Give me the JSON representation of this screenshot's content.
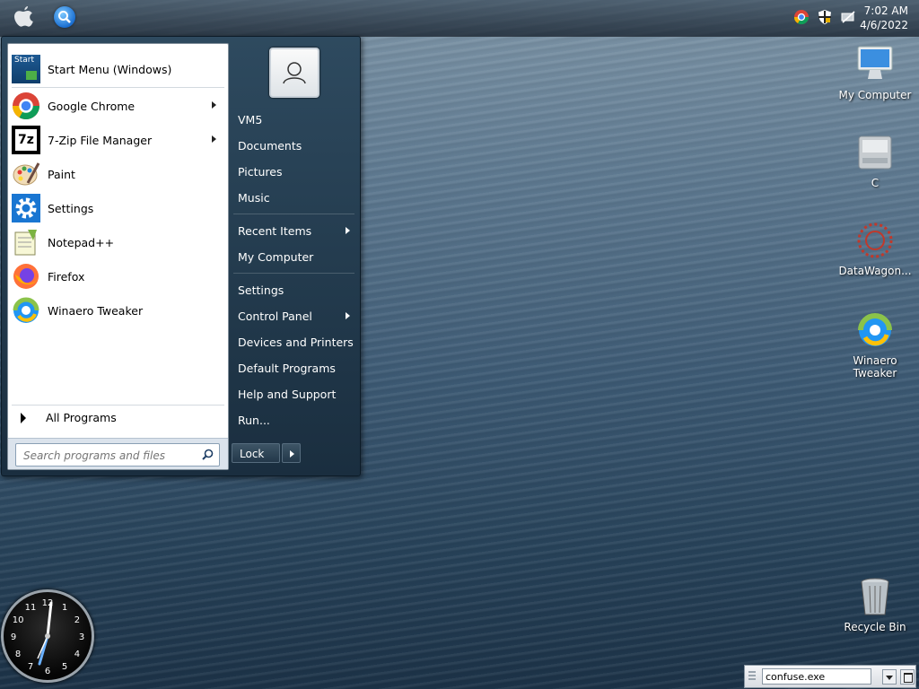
{
  "clock": {
    "time": "7:02 AM",
    "date": "4/6/2022"
  },
  "start_menu": {
    "pinned": [
      {
        "label": "Start Menu (Windows)",
        "icon": "start-menu-icon",
        "has_submenu": false
      },
      {
        "label": "Google Chrome",
        "icon": "chrome-icon",
        "has_submenu": true
      },
      {
        "label": "7-Zip File Manager",
        "icon": "7zip-icon",
        "has_submenu": true
      },
      {
        "label": "Paint",
        "icon": "paint-icon",
        "has_submenu": false
      },
      {
        "label": "Settings",
        "icon": "gear-icon",
        "has_submenu": false
      },
      {
        "label": "Notepad++",
        "icon": "notepadpp-icon",
        "has_submenu": false
      },
      {
        "label": "Firefox",
        "icon": "firefox-icon",
        "has_submenu": false
      },
      {
        "label": "Winaero Tweaker",
        "icon": "winaero-icon",
        "has_submenu": false
      }
    ],
    "start_icon_text": "Start",
    "all_programs": "All Programs",
    "search_placeholder": "Search programs and files",
    "right": {
      "user": "VM5",
      "documents": "Documents",
      "pictures": "Pictures",
      "music": "Music",
      "recent_items": "Recent Items",
      "my_computer": "My Computer",
      "settings": "Settings",
      "control_panel": "Control Panel",
      "devices_printers": "Devices and Printers",
      "default_programs": "Default Programs",
      "help_support": "Help and Support",
      "run": "Run..."
    },
    "lock": "Lock",
    "zip_icon_text": "7z"
  },
  "desktop": {
    "my_computer": "My Computer",
    "c_drive": "C",
    "datawagon": "DataWagon...",
    "winaero_line1": "Winaero",
    "winaero_line2": "Tweaker",
    "recycle_bin": "Recycle Bin"
  },
  "clock_gadget": {
    "numbers": [
      "12",
      "1",
      "2",
      "3",
      "4",
      "5",
      "6",
      "7",
      "8",
      "9",
      "10",
      "11"
    ]
  },
  "toolbar": {
    "run_value": "confuse.exe"
  },
  "colors": {
    "desktop_top": "#7f96a8",
    "desktop_bottom": "#1c3247",
    "menu_dark": "#1a2e3f",
    "chrome_blue": "#1b6fd1"
  }
}
